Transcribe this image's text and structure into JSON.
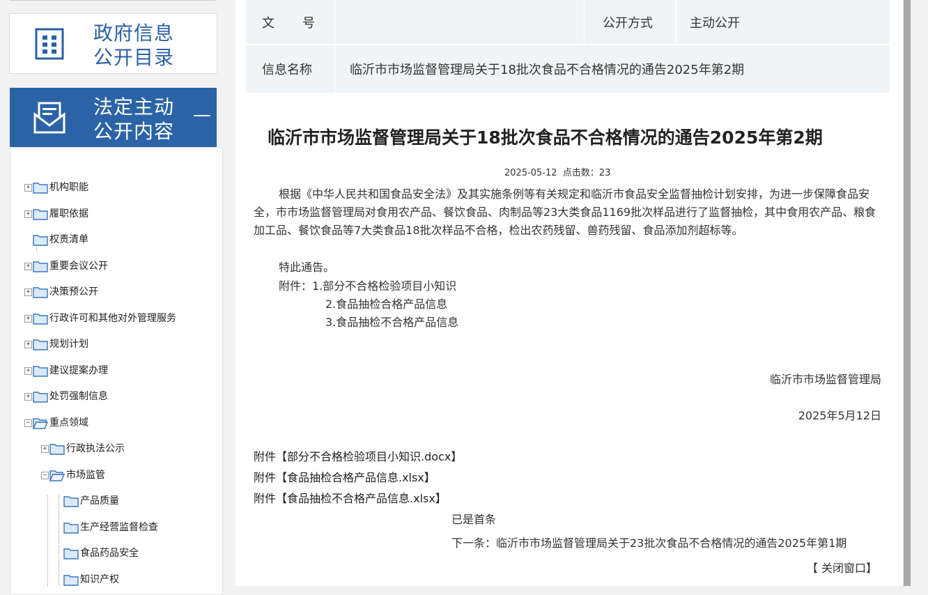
{
  "sidebar": {
    "directory_box": {
      "title_line1": "政府信息",
      "title_line2": "公开目录"
    },
    "active_box": {
      "title_line1": "法定主动",
      "title_line2": "公开内容",
      "collapse": "—"
    },
    "tree": [
      {
        "label": "机构职能",
        "toggle": "+"
      },
      {
        "label": "履职依据",
        "toggle": "+"
      },
      {
        "label": "权责清单",
        "toggle": ""
      },
      {
        "label": "重要会议公开",
        "toggle": "+"
      },
      {
        "label": "决策预公开",
        "toggle": "+"
      },
      {
        "label": "行政许可和其他对外管理服务",
        "toggle": "+"
      },
      {
        "label": "规划计划",
        "toggle": "+"
      },
      {
        "label": "建议提案办理",
        "toggle": "+"
      },
      {
        "label": "处罚强制信息",
        "toggle": "+"
      },
      {
        "label": "重点领域",
        "toggle": "−"
      },
      {
        "label": "行政执法公示",
        "toggle": "+"
      },
      {
        "label": "市场监管",
        "toggle": "−"
      },
      {
        "label": "产品质量",
        "toggle": ""
      },
      {
        "label": "生产经营监督检查",
        "toggle": ""
      },
      {
        "label": "食品药品安全",
        "toggle": ""
      },
      {
        "label": "知识产权",
        "toggle": ""
      }
    ]
  },
  "meta": {
    "doc_no_label": "文       号",
    "doc_no_value": "",
    "method_label": "公开方式",
    "method_value": "主动公开",
    "name_label": "信息名称",
    "name_value": "临沂市市场监督管理局关于18批次食品不合格情况的通告2025年第2期"
  },
  "article": {
    "title": "临沂市市场监督管理局关于18批次食品不合格情况的通告2025年第2期",
    "date": "2025-05-12",
    "clicks_label": "点击数：",
    "clicks": "23",
    "body": "根据《中华人民共和国食品安全法》及其实施条例等有关规定和临沂市食品安全监督抽检计划安排，为进一步保障食品安全，市市场监督管理局对食用农产品、餐饮食品、肉制品等23大类食品1169批次样品进行了监督抽检，其中食用农产品、粮食加工品、餐饮食品等7大类食品18批次样品不合格，检出农药残留、兽药残留、食品添加剂超标等。",
    "notice": "特此通告。",
    "attach_intro": "附件：1.部分不合格检验项目小知识",
    "attach_2": "2.食品抽检合格产品信息",
    "attach_3": "3.食品抽检不合格产品信息",
    "signature": "临沂市市场监督管理局",
    "sign_date": "2025年5月12日",
    "attachments": [
      "附件【部分不合格检验项目小知识.docx】",
      "附件【食品抽检合格产品信息.xlsx】",
      "附件【食品抽检不合格产品信息.xlsx】"
    ],
    "prev": "已是首条",
    "next": "下一条：临沂市市场监督管理局关于23批次食品不合格情况的通告2025年第1期",
    "close": "【 关闭窗口】"
  },
  "colors": {
    "brand_blue": "#2b63a6",
    "meta_bg": "#f1f4f6"
  },
  "icons": {
    "directory": "grid-document-icon",
    "active": "envelope-document-icon",
    "tree": "folder-icon"
  }
}
